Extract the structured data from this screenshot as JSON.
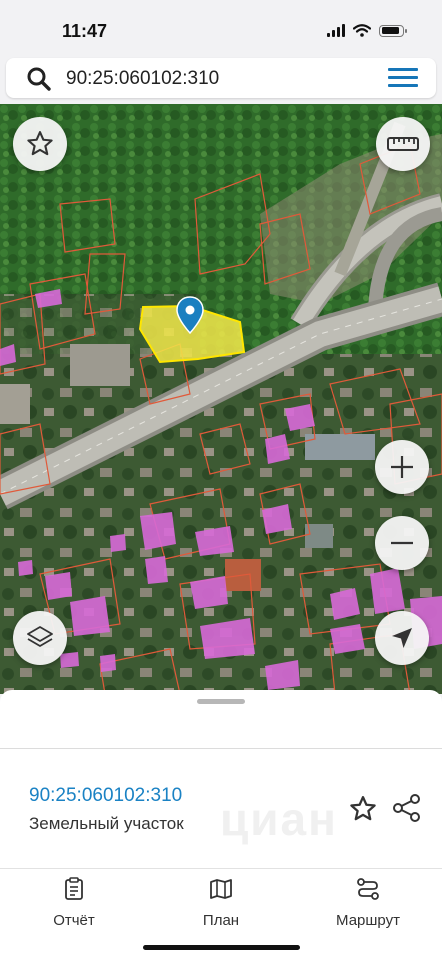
{
  "status_bar": {
    "time": "11:47"
  },
  "search": {
    "value": "90:25:060102:310"
  },
  "map": {
    "marker": "map-pin-icon",
    "parcel_highlight_color": "#f2e84a",
    "buildings_color": "#d86ad8",
    "boundary_color": "#e05a3a"
  },
  "sheet": {
    "parcel_id": "90:25:060102:310",
    "parcel_type": "Земельный участок",
    "watermark": "циан"
  },
  "tabs": [
    {
      "label": "Отчёт",
      "icon": "report-icon"
    },
    {
      "label": "План",
      "icon": "map-icon"
    },
    {
      "label": "Маршрут",
      "icon": "route-icon"
    }
  ],
  "colors": {
    "accent": "#1a82c4",
    "menu": "#1676b8"
  }
}
